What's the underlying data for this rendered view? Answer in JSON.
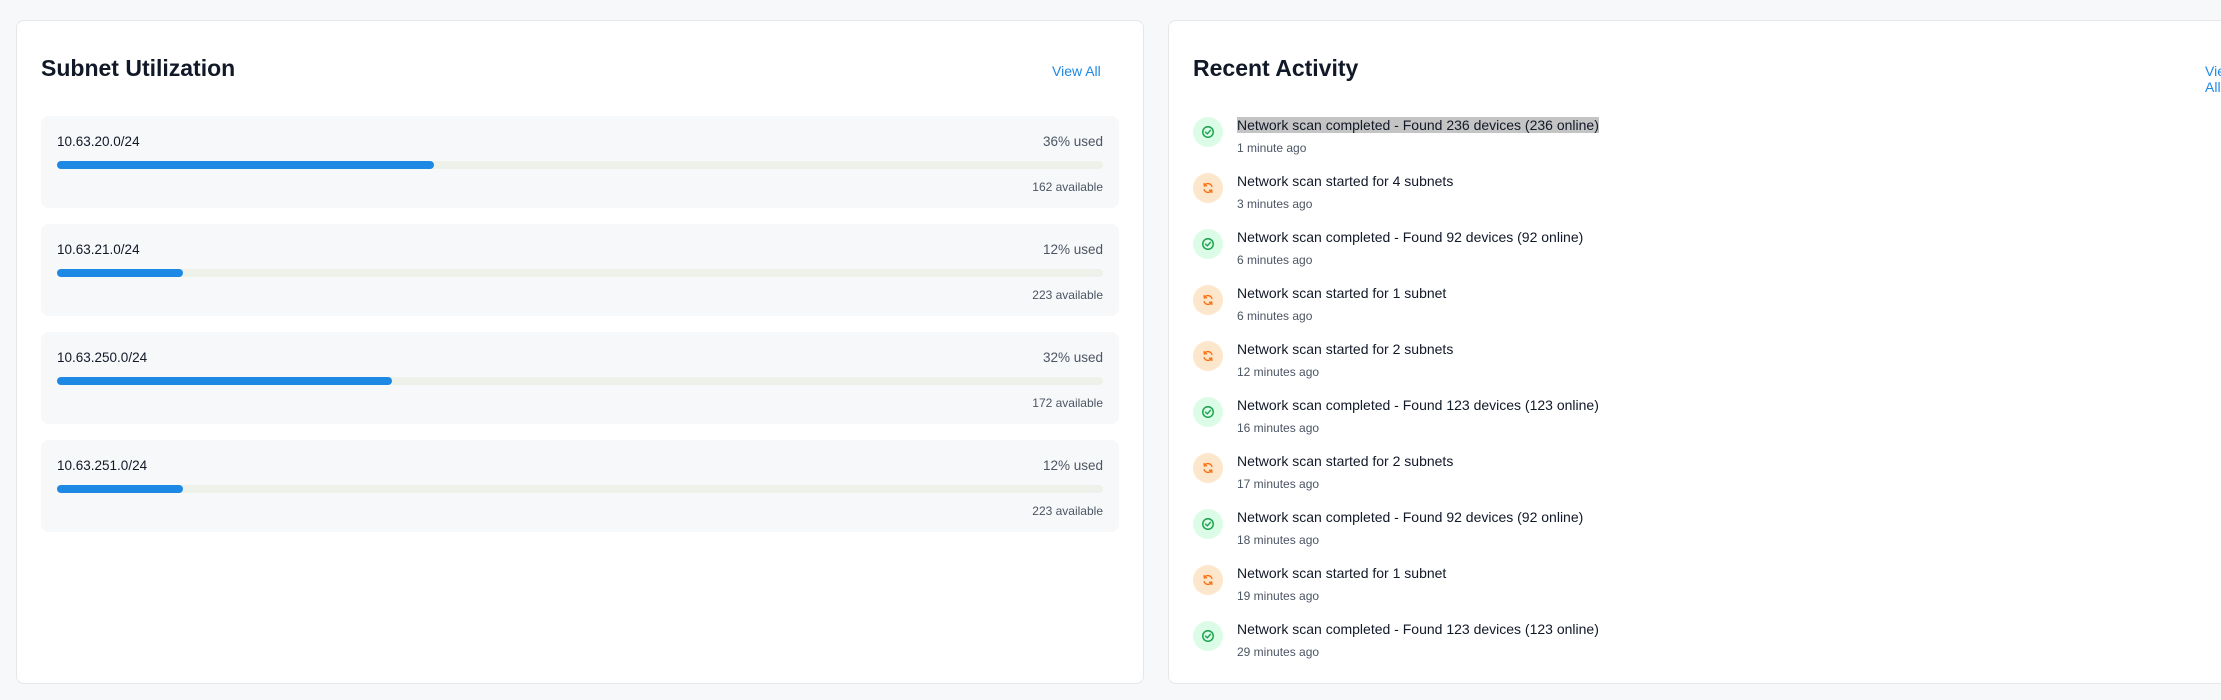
{
  "subnets_card": {
    "title": "Subnet Utilization",
    "view_all": "View All",
    "items": [
      {
        "name": "10.63.20.0/24",
        "used_label": "36% used",
        "used_fraction": 0.36,
        "available_label": "162 available"
      },
      {
        "name": "10.63.21.0/24",
        "used_label": "12% used",
        "used_fraction": 0.12,
        "available_label": "223 available"
      },
      {
        "name": "10.63.250.0/24",
        "used_label": "32% used",
        "used_fraction": 0.32,
        "available_label": "172 available"
      },
      {
        "name": "10.63.251.0/24",
        "used_label": "12% used",
        "used_fraction": 0.12,
        "available_label": "223 available"
      }
    ]
  },
  "activity_card": {
    "title": "Recent Activity",
    "view_all": "View All",
    "items": [
      {
        "type": "success",
        "icon": "check-circle-icon",
        "text": "Network scan completed - Found 236 devices (236 online)",
        "time": "1 minute ago",
        "selected": true
      },
      {
        "type": "scan",
        "icon": "refresh-icon",
        "text": "Network scan started for 4 subnets",
        "time": "3 minutes ago"
      },
      {
        "type": "success",
        "icon": "check-circle-icon",
        "text": "Network scan completed - Found 92 devices (92 online)",
        "time": "6 minutes ago"
      },
      {
        "type": "scan",
        "icon": "refresh-icon",
        "text": "Network scan started for 1 subnet",
        "time": "6 minutes ago"
      },
      {
        "type": "scan",
        "icon": "refresh-icon",
        "text": "Network scan started for 2 subnets",
        "time": "12 minutes ago"
      },
      {
        "type": "success",
        "icon": "check-circle-icon",
        "text": "Network scan completed - Found 123 devices (123 online)",
        "time": "16 minutes ago"
      },
      {
        "type": "scan",
        "icon": "refresh-icon",
        "text": "Network scan started for 2 subnets",
        "time": "17 minutes ago"
      },
      {
        "type": "success",
        "icon": "check-circle-icon",
        "text": "Network scan completed - Found 92 devices (92 online)",
        "time": "18 minutes ago"
      },
      {
        "type": "scan",
        "icon": "refresh-icon",
        "text": "Network scan started for 1 subnet",
        "time": "19 minutes ago"
      },
      {
        "type": "success",
        "icon": "check-circle-icon",
        "text": "Network scan completed - Found 123 devices (123 online)",
        "time": "29 minutes ago"
      }
    ]
  },
  "colors": {
    "accent": "#1e88e5",
    "success_bg": "#dcfce7",
    "success_fg": "#16a34a",
    "scan_bg": "#fde7cc",
    "scan_fg": "#f97316"
  }
}
